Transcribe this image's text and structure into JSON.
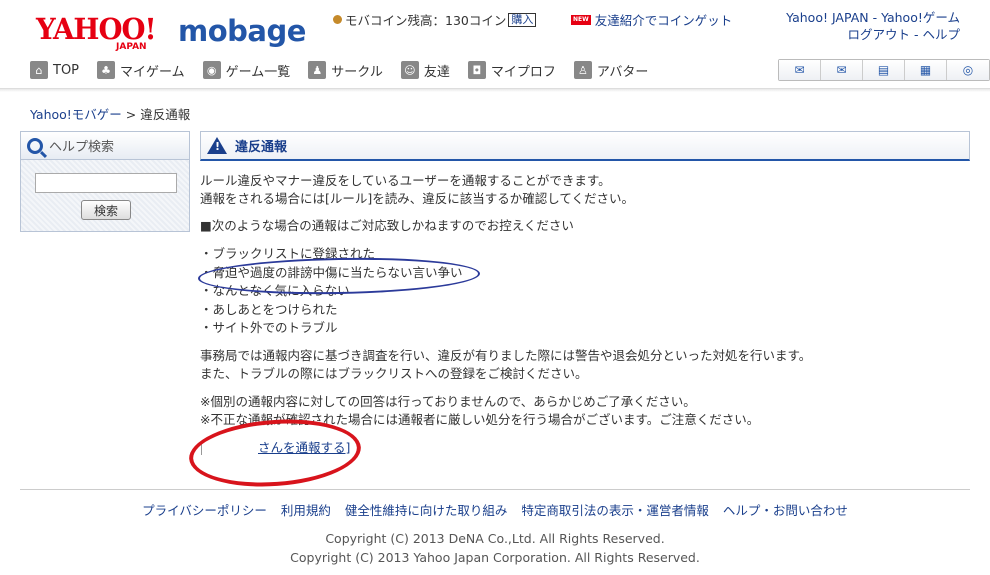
{
  "header": {
    "logo": {
      "yahoo": "YAHOO!",
      "japan": "JAPAN",
      "mobage": "mobage"
    },
    "coin_text": "モバコイン残高：130コイン",
    "buy_label": "購入",
    "friend_new_badge": "NEW",
    "friend_text": "友達紹介でコインゲット",
    "links_line1": "Yahoo! JAPAN - Yahoo!ゲーム",
    "links_line2": "ログアウト - ヘルプ"
  },
  "nav": {
    "items": [
      {
        "label": "TOP",
        "icon": "home-icon"
      },
      {
        "label": "マイゲーム",
        "icon": "my-game-icon"
      },
      {
        "label": "ゲーム一覧",
        "icon": "game-controller-icon"
      },
      {
        "label": "サークル",
        "icon": "circle-group-icon"
      },
      {
        "label": "友達",
        "icon": "friends-icon"
      },
      {
        "label": "マイプロフ",
        "icon": "profile-icon"
      },
      {
        "label": "アバター",
        "icon": "avatar-icon"
      }
    ],
    "icon_buttons": [
      "chat-icon",
      "mail-icon",
      "inbox-icon",
      "news-icon",
      "game-pad-icon"
    ]
  },
  "breadcrumb": {
    "home": "Yahoo!モバゲー",
    "sep": ">",
    "current": "違反通報"
  },
  "help": {
    "title": "ヘルプ検索",
    "search_value": "",
    "button": "検索"
  },
  "main": {
    "title": "違反通報",
    "intro_line1": "ルール違反やマナー違反をしているユーザーを通報することができます。",
    "intro_line2": "通報をされる場合には[ルール]を読み、違反に該当するか確認してください。",
    "notice_heading": "■次のような場合の通報はご対応致しかねますのでお控えください",
    "list": [
      "・ブラックリストに登録された",
      "・脅迫や過度の誹謗中傷に当たらない言い争い",
      "・なんとなく気に入らない",
      "・あしあとをつけられた",
      "・サイト外でのトラブル"
    ],
    "process_line1": "事務局では通報内容に基づき調査を行い、違反が有りました際には警告や退会処分といった対処を行います。",
    "process_line2": "また、トラブルの際にはブラックリストへの登録をご検討ください。",
    "note_line1": "※個別の通報内容に対しての回答は行っておりませんので、あらかじめご了承ください。",
    "note_line2": "※不正な通報が確認された場合には通報者に厳しい処分を行う場合がございます。ご注意ください。",
    "report_link": "さんを通報する]"
  },
  "footer": {
    "links": [
      "プライバシーポリシー",
      "利用規約",
      "健全性維持に向けた取り組み",
      "特定商取引法の表示・運営者情報",
      "ヘルプ・お問い合わせ"
    ],
    "copyright1": "Copyright (C) 2013 DeNA Co.,Ltd. All Rights Reserved.",
    "copyright2": "Copyright (C) 2013 Yahoo Japan Corporation. All Rights Reserved."
  },
  "colors": {
    "brand_red": "#e60012",
    "brand_blue": "#2356a8",
    "annotation_blue": "#2b3a9a",
    "annotation_red": "#d8141c"
  }
}
